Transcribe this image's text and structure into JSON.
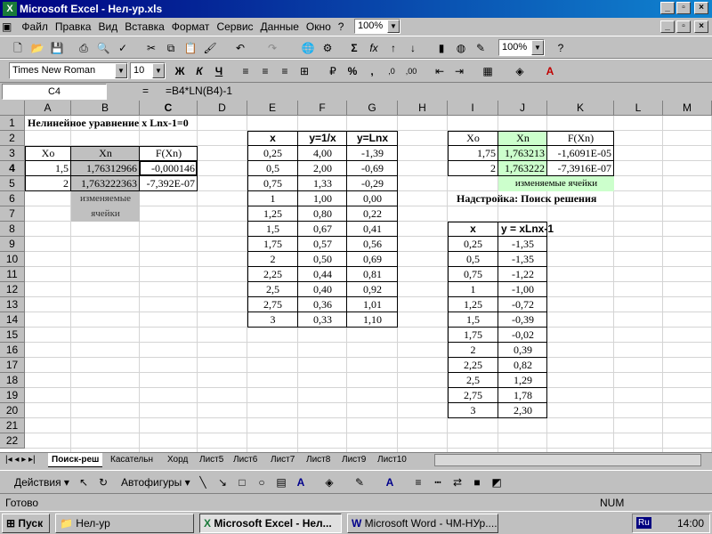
{
  "window": {
    "title": "Microsoft Excel - Нел-ур.xls"
  },
  "menu": [
    "Файл",
    "Правка",
    "Вид",
    "Вставка",
    "Формат",
    "Сервис",
    "Данные",
    "Окно",
    "?"
  ],
  "menu_zoom": "100%",
  "toolbar": {
    "zoom": "100%",
    "font": "Times New Roman",
    "size": "10",
    "bold": "Ж",
    "italic": "К",
    "underline": "Ч"
  },
  "formula_bar": {
    "name_box": "C4",
    "equals": "=",
    "formula": "=B4*LN(B4)-1"
  },
  "columns": [
    "A",
    "B",
    "C",
    "D",
    "E",
    "F",
    "G",
    "H",
    "I",
    "J",
    "K",
    "L",
    "M"
  ],
  "rows": [
    "1",
    "2",
    "3",
    "4",
    "5",
    "6",
    "7",
    "8",
    "9",
    "10",
    "11",
    "12",
    "13",
    "14",
    "15",
    "16",
    "17",
    "18",
    "19",
    "20",
    "21",
    "22"
  ],
  "sheet": {
    "title": "Нелинейное уравнение  x Lnx-1=0",
    "left_table": {
      "headers": [
        "Xo",
        "Xn",
        "F(Xn)"
      ],
      "rows": [
        [
          "1,5",
          "1,76312966",
          "-0,000146"
        ],
        [
          "2",
          "1,763222363",
          "-7,392E-07"
        ]
      ],
      "note": [
        "изменяемые",
        "ячейки"
      ]
    },
    "mid_table": {
      "headers": [
        "x",
        "y=1/x",
        "y=Lnx"
      ],
      "rows": [
        [
          "0,25",
          "4,00",
          "-1,39"
        ],
        [
          "0,5",
          "2,00",
          "-0,69"
        ],
        [
          "0,75",
          "1,33",
          "-0,29"
        ],
        [
          "1",
          "1,00",
          "0,00"
        ],
        [
          "1,25",
          "0,80",
          "0,22"
        ],
        [
          "1,5",
          "0,67",
          "0,41"
        ],
        [
          "1,75",
          "0,57",
          "0,56"
        ],
        [
          "2",
          "0,50",
          "0,69"
        ],
        [
          "2,25",
          "0,44",
          "0,81"
        ],
        [
          "2,5",
          "0,40",
          "0,92"
        ],
        [
          "2,75",
          "0,36",
          "1,01"
        ],
        [
          "3",
          "0,33",
          "1,10"
        ]
      ]
    },
    "right_table": {
      "headers": [
        "Xo",
        "Xn",
        "F(Xn)"
      ],
      "rows": [
        [
          "1,75",
          "1,763213",
          "-1,6091E-05"
        ],
        [
          "2",
          "1,763222",
          "-7,3916E-07"
        ]
      ],
      "note": "изменяемые ячейки",
      "addin": "Надстройка: Поиск решения"
    },
    "bottom_table": {
      "headers": [
        "x",
        "y = xLnx-1"
      ],
      "rows": [
        [
          "0,25",
          "-1,35"
        ],
        [
          "0,5",
          "-1,35"
        ],
        [
          "0,75",
          "-1,22"
        ],
        [
          "1",
          "-1,00"
        ],
        [
          "1,25",
          "-0,72"
        ],
        [
          "1,5",
          "-0,39"
        ],
        [
          "1,75",
          "-0,02"
        ],
        [
          "2",
          "0,39"
        ],
        [
          "2,25",
          "0,82"
        ],
        [
          "2,5",
          "1,29"
        ],
        [
          "2,75",
          "1,78"
        ],
        [
          "3",
          "2,30"
        ]
      ]
    }
  },
  "tabs": [
    "Поиск-реш",
    "Касательн",
    "Хорд",
    "Лист5",
    "Лист6",
    "Лист7",
    "Лист8",
    "Лист9",
    "Лист10"
  ],
  "draw": {
    "actions": "Действия",
    "autoshapes": "Автофигуры"
  },
  "status": {
    "ready": "Готово",
    "num": "NUM"
  },
  "taskbar": {
    "start": "Пуск",
    "items": [
      "Нел-ур",
      "Microsoft Excel - Нел...",
      "Microsoft Word - ЧМ-НУр...."
    ],
    "lang": "Ru",
    "time": "14:00"
  },
  "colors": {
    "gray_cell": "#c0c0c0",
    "green_cell": "#ccffcc",
    "title_blue": "#000080"
  }
}
